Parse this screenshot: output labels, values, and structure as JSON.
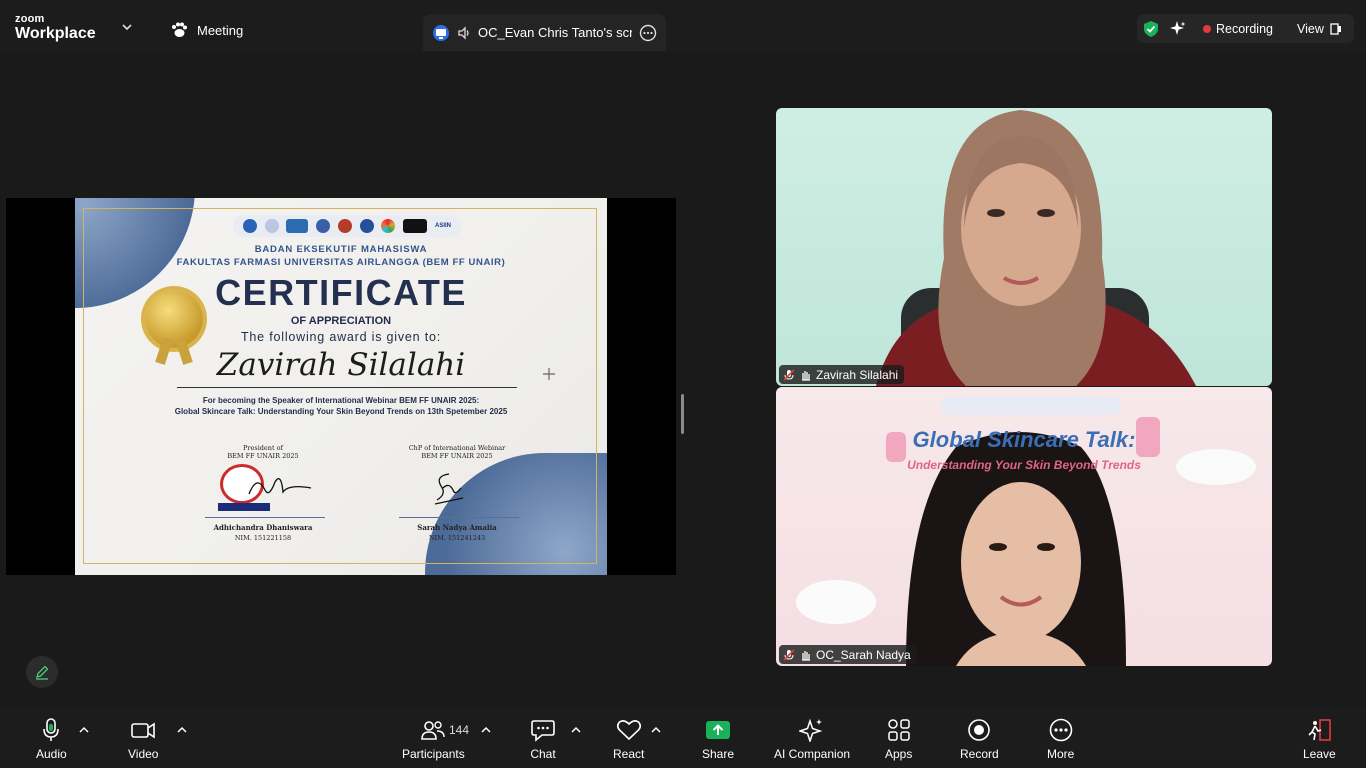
{
  "topbar": {
    "brand_small": "zoom",
    "brand_large": "Workplace",
    "meeting_label": "Meeting",
    "share_title": "OC_Evan Chris Tanto's screen",
    "recording_label": "Recording",
    "view_label": "View",
    "colors": {
      "recording": "#e23b3b",
      "shield": "#19b15a"
    }
  },
  "certificate": {
    "org_line1": "BADAN EKSEKUTIF MAHASISWA",
    "org_line2": "FAKULTAS FARMASI UNIVERSITAS AIRLANGGA (BEM FF UNAIR)",
    "title": "CERTIFICATE",
    "subtitle": "OF APPRECIATION",
    "given_to": "The following award is given to:",
    "recipient": "Zavirah Silalahi",
    "description_line1": "For becoming the Speaker of International Webinar BEM FF UNAIR 2025:",
    "description_line2": "Global Skincare Talk: Understanding Your Skin Beyond Trends on 13th Spetember 2025",
    "signer1_role_line1": "President of",
    "signer1_role_line2": "BEM FF UNAIR 2025",
    "signer1_name": "Adhichandra Dhaniswara",
    "signer1_nim": "NIM. 151221158",
    "signer2_role_line1": "ChP of International Webinar",
    "signer2_role_line2": "BEM FF UNAIR 2025",
    "signer2_name": "Sarah Nadya Amalia",
    "signer2_nim": "NIM. 151241243",
    "logo_strip_label": "ASIIN"
  },
  "participants": [
    {
      "name": "Zavirah Silalahi",
      "muted": true
    },
    {
      "name": "OC_Sarah Nadya",
      "muted": true
    }
  ],
  "tile2_banner": {
    "line1": "Global Skincare Talk:",
    "line2": "Understanding Your Skin Beyond Trends"
  },
  "toolbar": {
    "audio": "Audio",
    "video": "Video",
    "participants": "Participants",
    "participants_count": "144",
    "chat": "Chat",
    "react": "React",
    "share": "Share",
    "ai_companion": "AI Companion",
    "apps": "Apps",
    "record": "Record",
    "more": "More",
    "leave": "Leave",
    "colors": {
      "share": "#19b15a",
      "leave": "#e23b3b"
    }
  }
}
